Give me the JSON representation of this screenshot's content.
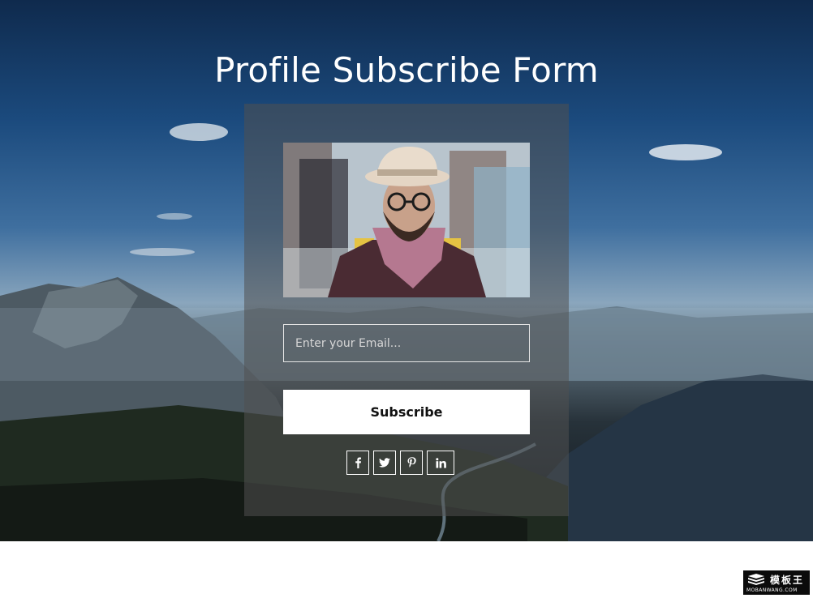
{
  "page": {
    "title": "Profile Subscribe Form"
  },
  "form": {
    "email": {
      "value": "",
      "placeholder": "Enter your Email..."
    },
    "subscribe_label": "Subscribe"
  },
  "social": [
    {
      "icon": "facebook-icon",
      "glyph": "f"
    },
    {
      "icon": "twitter-icon",
      "glyph": "t"
    },
    {
      "icon": "pinterest-icon",
      "glyph": "p"
    },
    {
      "icon": "linkedin-icon",
      "glyph": "in"
    }
  ],
  "watermark": {
    "cn": "模板王",
    "en": "MOBANWANG.COM"
  },
  "colors": {
    "overlay": "#505050",
    "button_bg": "#ffffff",
    "text_light": "#ffffff"
  }
}
